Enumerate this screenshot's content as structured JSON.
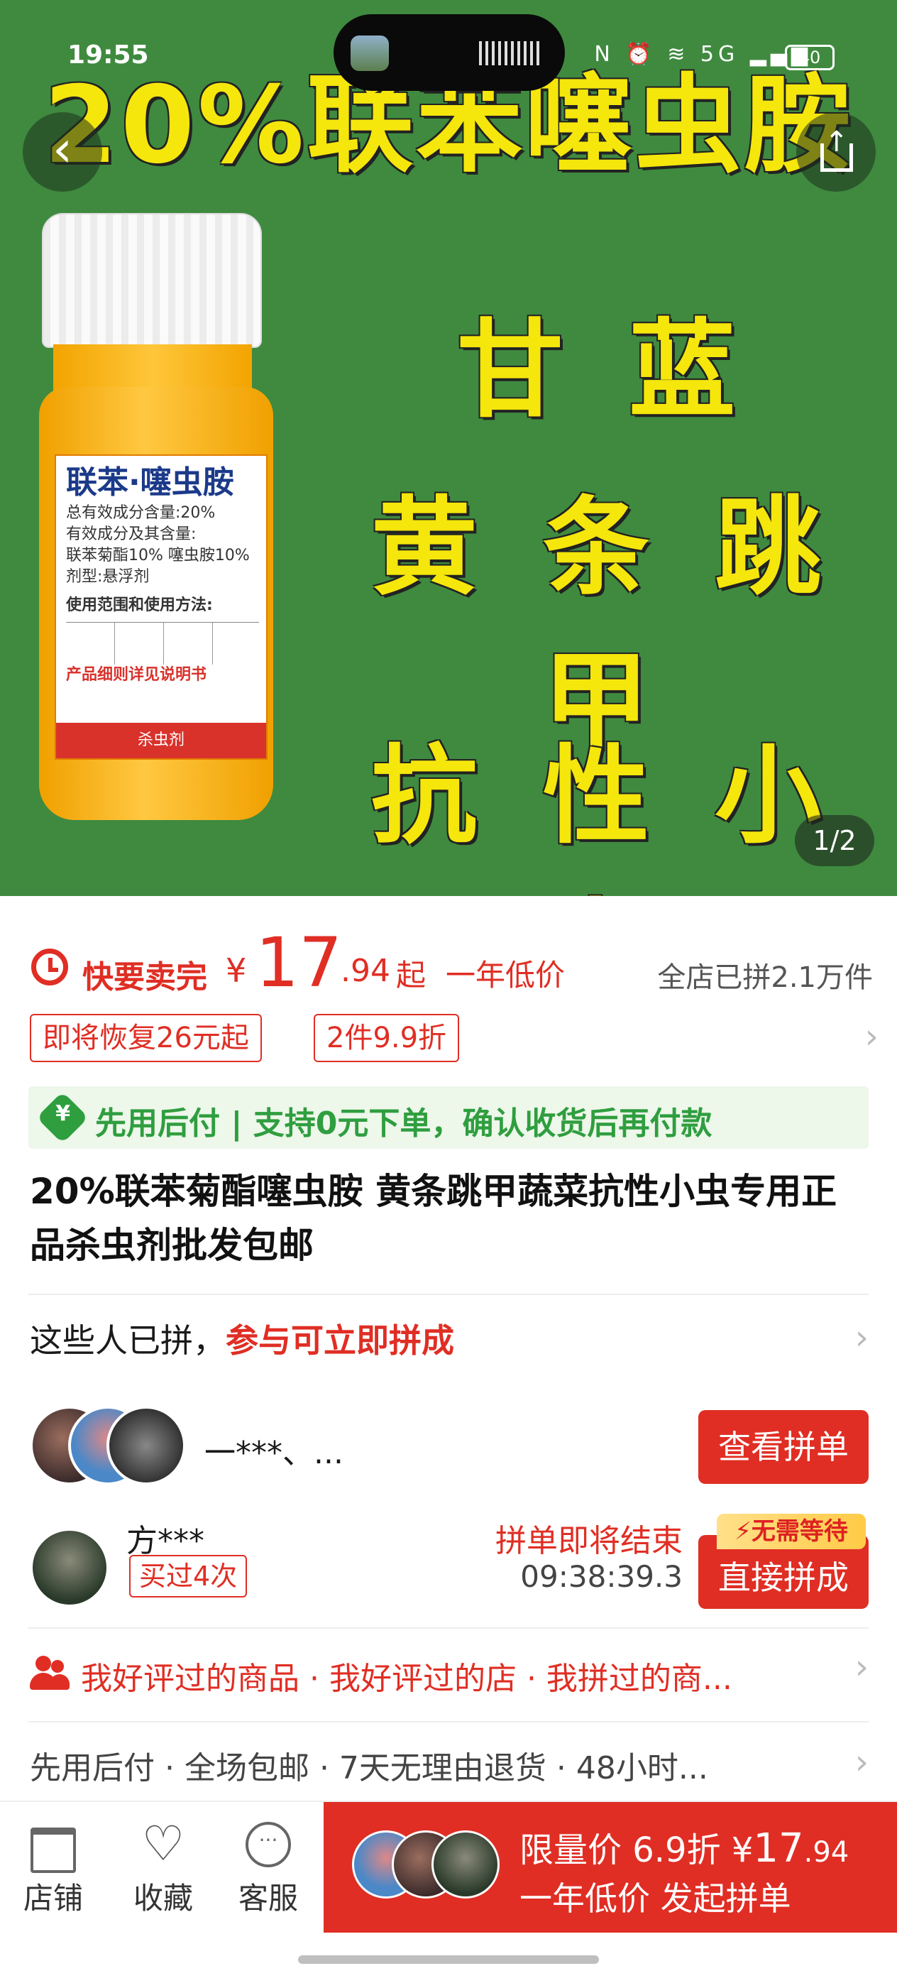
{
  "status_bar": {
    "time": "19:55",
    "icons": "N ⏰ ≋ 5G ▂▄▆",
    "battery": "40"
  },
  "hero": {
    "headline": "20%联苯噻虫胺",
    "line1": "甘 蓝",
    "line2": "黄 条 跳 甲",
    "line3": "抗 性 小 虫",
    "bottle_label": {
      "title": "联苯·噻虫胺",
      "lines": [
        "总有效成分含量:20%",
        "有效成分及其含量:",
        "联苯菊酯10% 噻虫胺10%",
        "剂型:悬浮剂"
      ],
      "usage": "使用范围和使用方法:",
      "note": "产品细则详见说明书",
      "category": "杀虫剂"
    },
    "image_counter": "1/2",
    "back_icon": "chevron-left-icon",
    "share_icon": "share-icon"
  },
  "price": {
    "hurry_label": "快要卖完",
    "currency": "¥",
    "integer": "17",
    "decimal": ".94",
    "suffix": "起",
    "low_label": "一年低价",
    "sold_text": "全店已拼2.1万件"
  },
  "tags": [
    "即将恢复26元起",
    "2件9.9折"
  ],
  "pay_banner": {
    "icon_glyph": "¥",
    "text": "先用后付 | 支持0元下单，确认收货后再付款"
  },
  "product_title": "20%联苯菊酯噻虫胺 黄条跳甲蔬菜抗性小虫专用正品杀虫剂批发包邮",
  "join": {
    "prefix": "这些人已拼，",
    "highlight": "参与可立即拼成"
  },
  "group1": {
    "names": "一***、...",
    "button": "查看拼单"
  },
  "group2": {
    "user": "方***",
    "bought_badge": "买过4次",
    "ending_label": "拼单即将结束",
    "countdown": "09:38:39.3",
    "no_wait_badge": "⚡无需等待",
    "button": "直接拼成"
  },
  "recommend": "我好评过的商品 · 我好评过的店 · 我拼过的商...",
  "services": "先用后付 · 全场包邮 · 7天无理由退货 · 48小时...",
  "bottom_nav": {
    "shop": "店铺",
    "favorite": "收藏",
    "service": "客服",
    "chat_glyph": "···"
  },
  "buy_button": {
    "line1_prefix": "限量价 6.9折 ",
    "currency": "¥",
    "integer": "17",
    "decimal": ".94",
    "line2": "一年低价 发起拼单"
  },
  "colors": {
    "accent": "#e02e24",
    "green": "#2f9e3f",
    "hero_bg": "#3f8a3f",
    "hero_text": "#f5e60c"
  }
}
